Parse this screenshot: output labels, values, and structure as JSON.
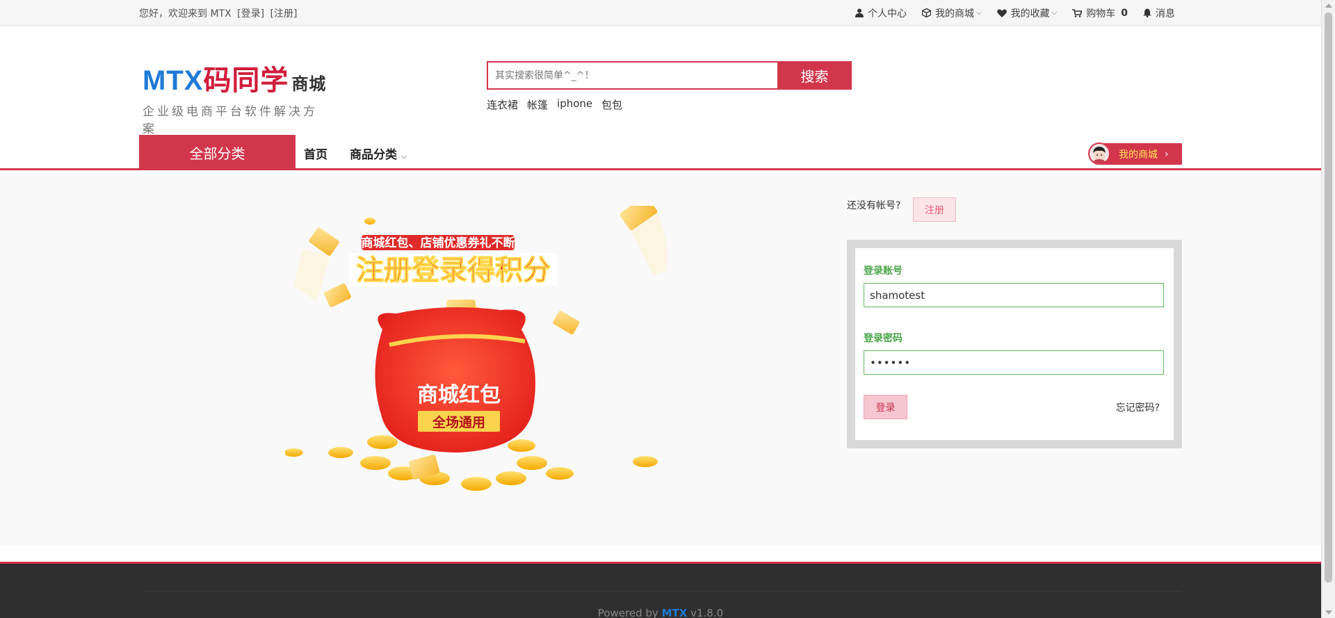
{
  "topbar": {
    "welcome": "您好，欢迎来到 MTX",
    "login_link": "[登录]",
    "register_link": "[注册]",
    "personal_center": "个人中心",
    "my_mall": "我的商城",
    "my_favorites": "我的收藏",
    "cart": "购物车",
    "cart_count": "0",
    "messages": "消息"
  },
  "logo": {
    "brand": "MTX",
    "brand_cn": "码同学",
    "shop": "商城",
    "slogan": "企业级电商平台软件解决方案"
  },
  "search": {
    "placeholder": "其实搜索很简单^_^！",
    "button": "搜索",
    "hot_words": [
      "连衣裙",
      "帐篷",
      "iphone",
      "包包"
    ]
  },
  "nav": {
    "all_categories": "全部分类",
    "home": "首页",
    "goods_category": "商品分类",
    "my_mall_button": "我的商城"
  },
  "banner": {
    "top_text": "商城红包、店铺优惠券礼不断",
    "main_text": "注册登录得积分",
    "bag_text": "商城红包",
    "bag_subtext": "全场通用"
  },
  "login": {
    "no_account": "还没有帐号?",
    "register_button": "注册",
    "account_label": "登录账号",
    "account_value": "shamotest",
    "password_label": "登录密码",
    "password_value": "••••••",
    "login_button": "登录",
    "forgot": "忘记密码?"
  },
  "footer": {
    "powered_prefix": "Powered by",
    "brand": "MTX",
    "version": "v1.8.0"
  },
  "colors": {
    "brand_red": "#d2364c",
    "brand_blue": "#1f7ad6",
    "label_green": "#4aa54a"
  }
}
